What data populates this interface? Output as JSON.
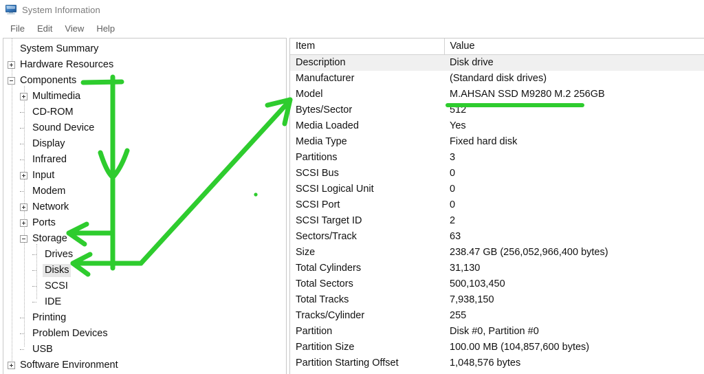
{
  "window": {
    "title": "System Information",
    "icon": "computer-monitor-icon"
  },
  "menubar": {
    "items": [
      {
        "label": "File"
      },
      {
        "label": "Edit"
      },
      {
        "label": "View"
      },
      {
        "label": "Help"
      }
    ]
  },
  "tree": {
    "items": [
      {
        "label": "System Summary",
        "depth": 0,
        "twisty": "none",
        "selected": false
      },
      {
        "label": "Hardware Resources",
        "depth": 0,
        "twisty": "plus",
        "selected": false
      },
      {
        "label": "Components",
        "depth": 0,
        "twisty": "minus",
        "selected": false
      },
      {
        "label": "Multimedia",
        "depth": 1,
        "twisty": "plus",
        "selected": false
      },
      {
        "label": "CD-ROM",
        "depth": 1,
        "twisty": "stub",
        "selected": false
      },
      {
        "label": "Sound Device",
        "depth": 1,
        "twisty": "stub",
        "selected": false
      },
      {
        "label": "Display",
        "depth": 1,
        "twisty": "stub",
        "selected": false
      },
      {
        "label": "Infrared",
        "depth": 1,
        "twisty": "stub",
        "selected": false
      },
      {
        "label": "Input",
        "depth": 1,
        "twisty": "plus",
        "selected": false
      },
      {
        "label": "Modem",
        "depth": 1,
        "twisty": "stub",
        "selected": false
      },
      {
        "label": "Network",
        "depth": 1,
        "twisty": "plus",
        "selected": false
      },
      {
        "label": "Ports",
        "depth": 1,
        "twisty": "plus",
        "selected": false
      },
      {
        "label": "Storage",
        "depth": 1,
        "twisty": "minus",
        "selected": false
      },
      {
        "label": "Drives",
        "depth": 2,
        "twisty": "stub",
        "selected": false
      },
      {
        "label": "Disks",
        "depth": 2,
        "twisty": "stub",
        "selected": true
      },
      {
        "label": "SCSI",
        "depth": 2,
        "twisty": "stub",
        "selected": false
      },
      {
        "label": "IDE",
        "depth": 2,
        "twisty": "stub",
        "selected": false
      },
      {
        "label": "Printing",
        "depth": 1,
        "twisty": "stub",
        "selected": false
      },
      {
        "label": "Problem Devices",
        "depth": 1,
        "twisty": "stub",
        "selected": false
      },
      {
        "label": "USB",
        "depth": 1,
        "twisty": "stub",
        "selected": false
      },
      {
        "label": "Software Environment",
        "depth": 0,
        "twisty": "plus",
        "selected": false
      }
    ]
  },
  "detail": {
    "columns": [
      "Item",
      "Value"
    ],
    "rows": [
      {
        "item": "Description",
        "value": "Disk drive",
        "highlight": true
      },
      {
        "item": "Manufacturer",
        "value": "(Standard disk drives)",
        "highlight": false
      },
      {
        "item": "Model",
        "value": "M.AHSAN SSD M9280 M.2 256GB",
        "highlight": false
      },
      {
        "item": "Bytes/Sector",
        "value": "512",
        "highlight": false
      },
      {
        "item": "Media Loaded",
        "value": "Yes",
        "highlight": false
      },
      {
        "item": "Media Type",
        "value": "Fixed hard disk",
        "highlight": false
      },
      {
        "item": "Partitions",
        "value": "3",
        "highlight": false
      },
      {
        "item": "SCSI Bus",
        "value": "0",
        "highlight": false
      },
      {
        "item": "SCSI Logical Unit",
        "value": "0",
        "highlight": false
      },
      {
        "item": "SCSI Port",
        "value": "0",
        "highlight": false
      },
      {
        "item": "SCSI Target ID",
        "value": "2",
        "highlight": false
      },
      {
        "item": "Sectors/Track",
        "value": "63",
        "highlight": false
      },
      {
        "item": "Size",
        "value": "238.47 GB (256,052,966,400 bytes)",
        "highlight": false
      },
      {
        "item": "Total Cylinders",
        "value": "31,130",
        "highlight": false
      },
      {
        "item": "Total Sectors",
        "value": "500,103,450",
        "highlight": false
      },
      {
        "item": "Total Tracks",
        "value": "7,938,150",
        "highlight": false
      },
      {
        "item": "Tracks/Cylinder",
        "value": "255",
        "highlight": false
      },
      {
        "item": "Partition",
        "value": "Disk #0, Partition #0",
        "highlight": false
      },
      {
        "item": "Partition Size",
        "value": "100.00 MB (104,857,600 bytes)",
        "highlight": false
      },
      {
        "item": "Partition Starting Offset",
        "value": "1,048,576 bytes",
        "highlight": false
      }
    ]
  },
  "annotations": {
    "color": "#2ecc2e",
    "marks": [
      {
        "name": "model-value-underline",
        "kind": "underline",
        "target": "Model"
      },
      {
        "name": "arrow-to-storage",
        "kind": "arrow",
        "target": "Storage"
      },
      {
        "name": "arrow-to-disks",
        "kind": "arrow",
        "target": "Disks"
      },
      {
        "name": "arrow-to-detail-panel",
        "kind": "arrow",
        "target": "Value column"
      },
      {
        "name": "arrow-down-components",
        "kind": "arrow",
        "target": "Components"
      },
      {
        "name": "ink-dot",
        "kind": "dot",
        "target": ""
      }
    ]
  }
}
